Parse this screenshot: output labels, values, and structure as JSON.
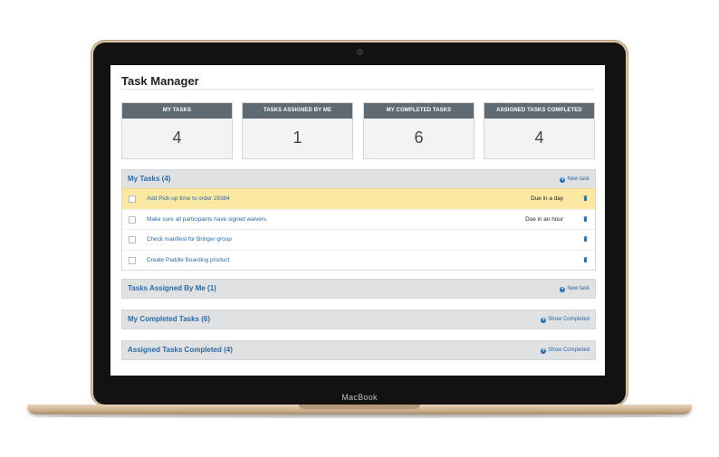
{
  "device": {
    "brand_label": "MacBook"
  },
  "app": {
    "title": "Task Manager"
  },
  "summary_cards": [
    {
      "label": "MY TASKS",
      "value": "4"
    },
    {
      "label": "TASKS ASSIGNED BY ME",
      "value": "1"
    },
    {
      "label": "MY COMPLETED TASKS",
      "value": "6"
    },
    {
      "label": "ASSIGNED TASKS COMPLETED",
      "value": "4"
    }
  ],
  "my_tasks": {
    "title": "My Tasks (4)",
    "action": "New task",
    "rows": [
      {
        "text": "Add Pick-up time to order 29384",
        "due": "Due in a day",
        "highlighted": true
      },
      {
        "text": "Make sure all participants have signed waivers",
        "due": "Due in an hour",
        "highlighted": false
      },
      {
        "text": "Check manifest for Bringer group",
        "due": "",
        "highlighted": false
      },
      {
        "text": "Create Paddle Boarding product",
        "due": "",
        "highlighted": false
      }
    ]
  },
  "assigned_by_me": {
    "title": "Tasks Assigned By Me (1)",
    "action": "New task"
  },
  "my_completed": {
    "title": "My Completed Tasks (6)",
    "action": "Show Completed"
  },
  "assigned_completed": {
    "title": "Assigned Tasks Completed (4)",
    "action": "Show Completed"
  },
  "colors": {
    "accent": "#2a6aa6",
    "card_header": "#5f6a72",
    "highlight_row": "#fbe8a3",
    "panel_header": "#dfe1e3"
  },
  "icons": {
    "add": "plus-circle-icon",
    "delete": "trash-icon",
    "checkbox": "checkbox"
  }
}
